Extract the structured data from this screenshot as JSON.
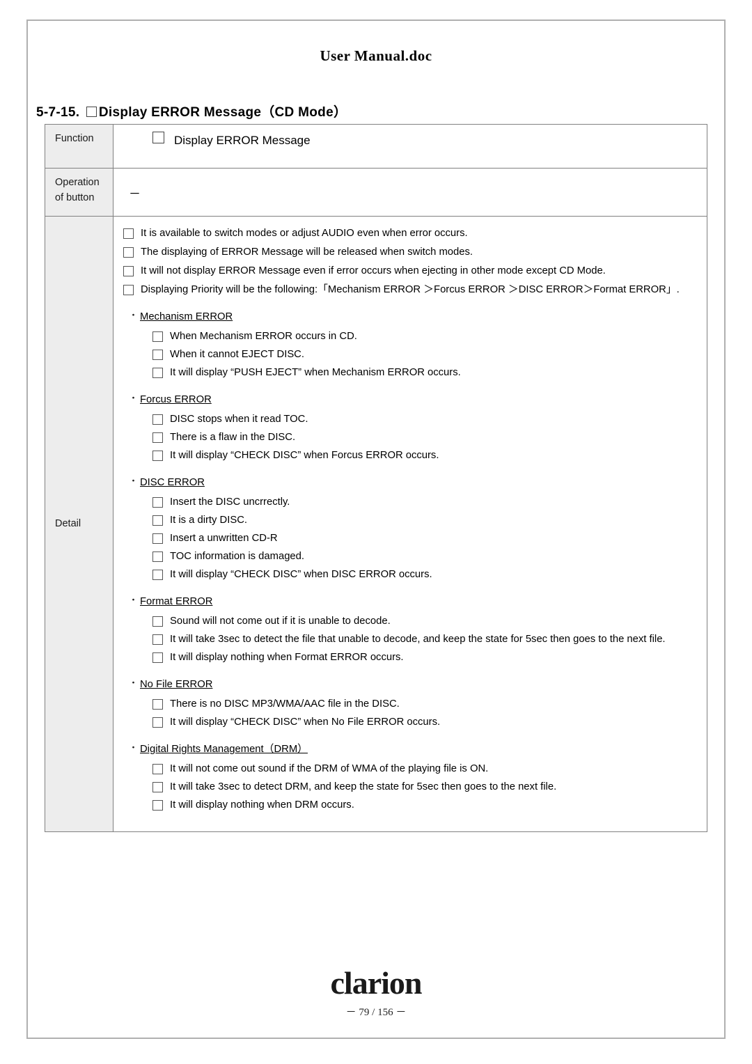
{
  "document": {
    "title": "User Manual.doc",
    "section_number": "5-7-15.",
    "section_title": "Display ERROR Message（CD Mode）",
    "page_footer": "－ 79 / 156 －",
    "logo_text": "clarion"
  },
  "table": {
    "labels": {
      "function": "Function",
      "operation_line1": "Operation",
      "operation_line2": "of button",
      "detail": "Detail"
    },
    "function_value": "Display ERROR Message",
    "operation_value": "－"
  },
  "detail": {
    "top_items": [
      "It is available to switch modes or adjust AUDIO even when error occurs.",
      "The displaying of ERROR Message will be released when switch modes.",
      "It will not display ERROR Message even if error occurs when ejecting in other mode except CD Mode.",
      "Displaying Priority will be the following:「Mechanism ERROR  ＞Forcus ERROR  ＞DISC ERROR＞Format ERROR」."
    ],
    "groups": [
      {
        "heading": "Mechanism ERROR",
        "items": [
          "When Mechanism ERROR occurs in CD.",
          "When it cannot EJECT DISC.",
          "It will display “PUSH  EJECT” when Mechanism ERROR occurs."
        ]
      },
      {
        "heading": "Forcus ERROR",
        "items": [
          "DISC stops when it read TOC.",
          "There is a flaw in the DISC.",
          "It will display “CHECK  DISC” when Forcus ERROR occurs."
        ]
      },
      {
        "heading": "DISC ERROR",
        "items": [
          "Insert the DISC uncrrectly.",
          "It is a dirty DISC.",
          "Insert a unwritten CD-R",
          "TOC information is damaged.",
          "It will display “CHECK  DISC” when DISC ERROR occurs."
        ]
      },
      {
        "heading": "Format ERROR",
        "items": [
          "Sound will not come out if it is unable to decode.",
          "It will take 3sec to detect the file that unable to decode, and keep the state for 5sec then goes to the next file.",
          "It will display nothing when Format ERROR occurs."
        ]
      },
      {
        "heading": "No File ERROR",
        "items": [
          "There is no DISC MP3/WMA/AAC file in the DISC.",
          " It will display “CHECK  DISC” when No File ERROR occurs."
        ]
      },
      {
        "heading": "Digital Rights Management（DRM）",
        "items": [
          "It will not come out sound if the DRM of WMA of the playing file is ON.",
          "It will take 3sec to detect DRM, and keep the state for 5sec then goes to the next file.",
          "It will display nothing when DRM occurs."
        ]
      }
    ]
  }
}
